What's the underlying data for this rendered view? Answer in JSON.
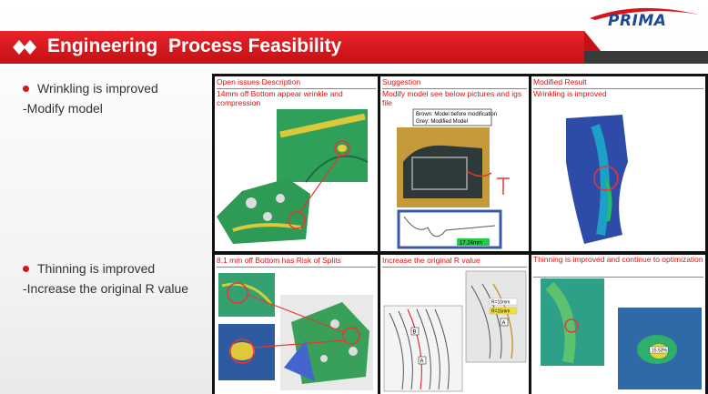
{
  "logo": {
    "text": "PRIMA",
    "icon": "prima-swoosh-logo"
  },
  "header": {
    "title": "Engineering  Process Feasibility",
    "icon": "diamond-bullets-icon",
    "accent_color": "#d7141a"
  },
  "bullets": [
    {
      "label": "Wrinkling is improved",
      "sub": "-Modify model"
    },
    {
      "label": "Thinning is improved",
      "sub": "-Increase the original R value"
    }
  ],
  "table": {
    "rows": [
      {
        "cells": [
          {
            "header": "Open issues Description",
            "text": "14mm off Bottom appear wrinkle and compression"
          },
          {
            "header": "Suggestion",
            "text": "Modify model see below pictures and igs file",
            "legend": [
              "Brown: Model before modification",
              "Grey: Modified Model"
            ],
            "measure": "17.24mm"
          },
          {
            "header": "Modified Result",
            "text": "Wrinkling is improved"
          }
        ]
      },
      {
        "cells": [
          {
            "header": "8.1 mm off  Bottom has Risk of Splits",
            "text": ""
          },
          {
            "header": "Increase the original R value",
            "text": "",
            "labels": [
              "B",
              "A",
              "A"
            ],
            "r_labels": [
              "R=10mm",
              "R=15mm"
            ]
          },
          {
            "header": "Thinning is improved and continue to optimization",
            "text": "",
            "thin_label": "15.53%"
          }
        ]
      }
    ]
  }
}
